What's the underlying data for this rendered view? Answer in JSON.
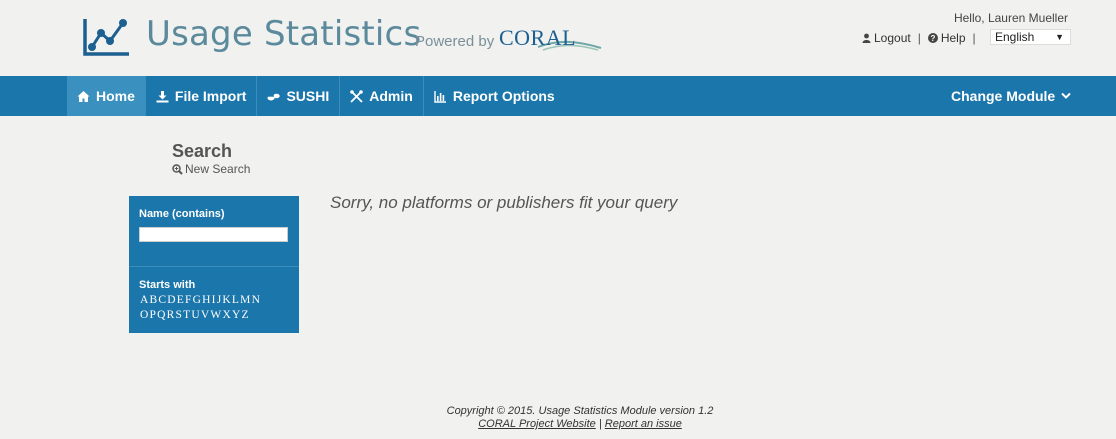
{
  "header": {
    "title": "Usage Statistics",
    "powered_by": "Powered by",
    "powered_brand": "CORAL",
    "greeting": "Hello, Lauren Mueller",
    "logout_label": "Logout",
    "help_label": "Help",
    "link_separator": "|",
    "language": "English"
  },
  "nav": {
    "items": [
      {
        "label": "Home",
        "icon": "home-icon",
        "active": true
      },
      {
        "label": "File Import",
        "icon": "download-icon"
      },
      {
        "label": "SUSHI",
        "icon": "sushi-icon"
      },
      {
        "label": "Admin",
        "icon": "wrench-icon"
      },
      {
        "label": "Report Options",
        "icon": "bar-chart-icon"
      }
    ],
    "change_module": "Change Module"
  },
  "search": {
    "title": "Search",
    "new_search": "New Search",
    "name_label": "Name (contains)",
    "name_value": "",
    "starts_with_label": "Starts with",
    "letters_row1": [
      "A",
      "B",
      "C",
      "D",
      "E",
      "F",
      "G",
      "H",
      "I",
      "J",
      "K",
      "L",
      "M",
      "N"
    ],
    "letters_row2": [
      "O",
      "P",
      "Q",
      "R",
      "S",
      "T",
      "U",
      "V",
      "W",
      "X",
      "Y",
      "Z"
    ]
  },
  "results": {
    "message": "Sorry, no platforms or publishers fit your query"
  },
  "footer": {
    "copyright": "Copyright © 2015. Usage Statistics Module version 1.2",
    "project_link": "CORAL Project Website",
    "separator": "|",
    "issue_link": "Report an issue"
  },
  "colors": {
    "nav_bg": "#1b76ab",
    "nav_active": "#3a90bf",
    "title": "#5b8a9c",
    "page_bg": "#f1f1ef"
  }
}
